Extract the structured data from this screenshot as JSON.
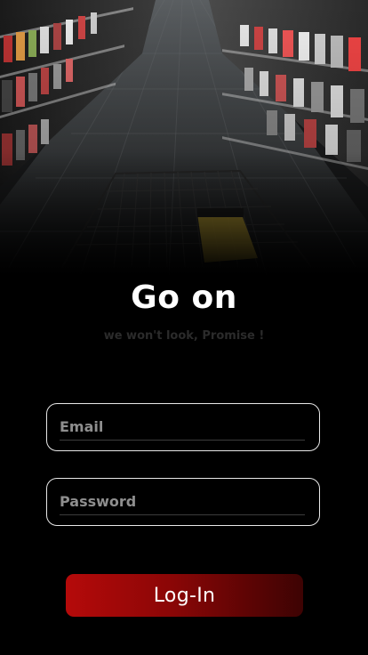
{
  "header": {
    "title": "Go on",
    "subtitle": "we won't look, Promise !"
  },
  "form": {
    "email": {
      "placeholder": "Email",
      "value": ""
    },
    "password": {
      "placeholder": "Password",
      "value": ""
    },
    "login_label": "Log-In"
  },
  "colors": {
    "background": "#000000",
    "button_start": "#b50a0a",
    "button_end": "#3d0303",
    "field_border": "#e8e8e8"
  }
}
